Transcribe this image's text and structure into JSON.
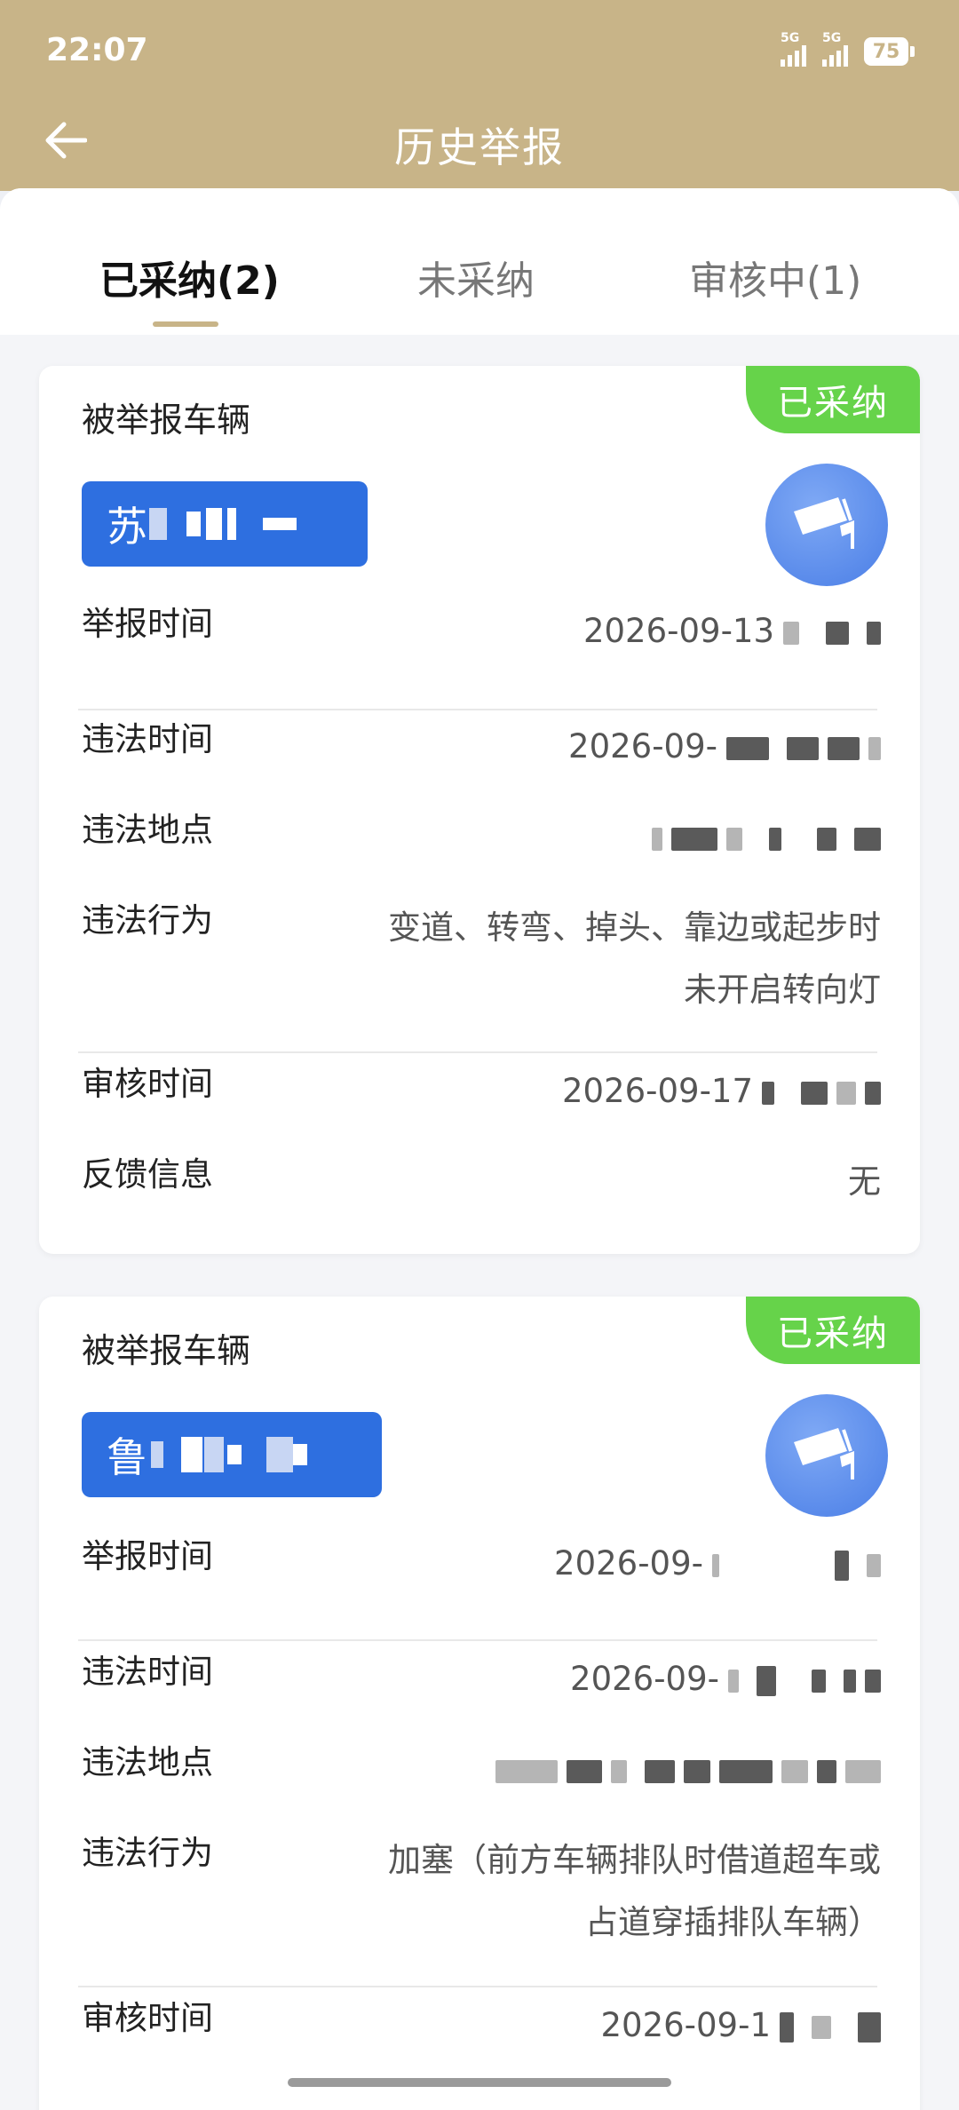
{
  "status_bar": {
    "time": "22:07",
    "signal1_label": "5G",
    "signal2_label": "5G",
    "battery": "75"
  },
  "header": {
    "title": "历史举报",
    "back_icon": "arrow-left-icon"
  },
  "tabs": [
    {
      "label": "已采纳(2)",
      "active": true
    },
    {
      "label": "未采纳",
      "active": false
    },
    {
      "label": "审核中(1)",
      "active": false
    }
  ],
  "labels": {
    "vehicle": "被举报车辆",
    "report_time": "举报时间",
    "violation_time": "违法时间",
    "violation_place": "违法地点",
    "violation_act": "违法行为",
    "review_time": "审核时间",
    "feedback": "反馈信息"
  },
  "cards": [
    {
      "status": "已采纳",
      "plate_prefix": "苏",
      "report_time": "2026-09-13",
      "violation_time": "2026-09-",
      "violation_place": "",
      "violation_act_line1": "变道、转弯、掉头、靠边或起步时",
      "violation_act_line2": "未开启转向灯",
      "review_time": "2026-09-17",
      "feedback": "无"
    },
    {
      "status": "已采纳",
      "plate_prefix": "鲁",
      "report_time": "2026-09-",
      "violation_time": "2026-09-",
      "violation_place": "",
      "violation_act_line1": "加塞（前方车辆排队时借道超车或",
      "violation_act_line2": "占道穿插排队车辆）",
      "review_time": "2026-09-1"
    }
  ],
  "colors": {
    "header": "#c8b488",
    "badge": "#66d34a",
    "plate": "#2e6fe0"
  }
}
